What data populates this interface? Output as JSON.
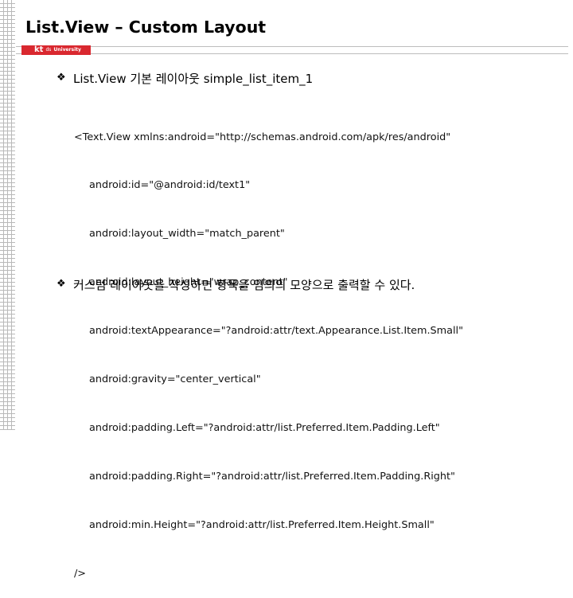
{
  "slide": {
    "title": "List.View – Custom Layout",
    "logo": {
      "kt": "kt",
      "ds": "ds",
      "university": "University"
    },
    "bullets": [
      {
        "icon": "diamond-bullet-icon",
        "text": "List.View 기본 레이아웃 simple_list_item_1"
      },
      {
        "icon": "diamond-bullet-icon",
        "text": "커스텀 레이아웃을 작성하면 항목을 임의의 모양으로 출력할 수 있다."
      }
    ],
    "code_lines": [
      "<Text.View xmlns:android=\"http://schemas.android.com/apk/res/android\"",
      "android:id=\"@android:id/text1\"",
      "android:layout_width=\"match_parent\"",
      "android:layout_height=\"wrap_content\"",
      "android:textAppearance=\"?android:attr/text.Appearance.List.Item.Small\"",
      "android:gravity=\"center_vertical\"",
      "android:padding.Left=\"?android:attr/list.Preferred.Item.Padding.Left\"",
      "android:padding.Right=\"?android:attr/list.Preferred.Item.Padding.Right\"",
      "android:min.Height=\"?android:attr/list.Preferred.Item.Height.Small\"",
      "/>"
    ]
  }
}
